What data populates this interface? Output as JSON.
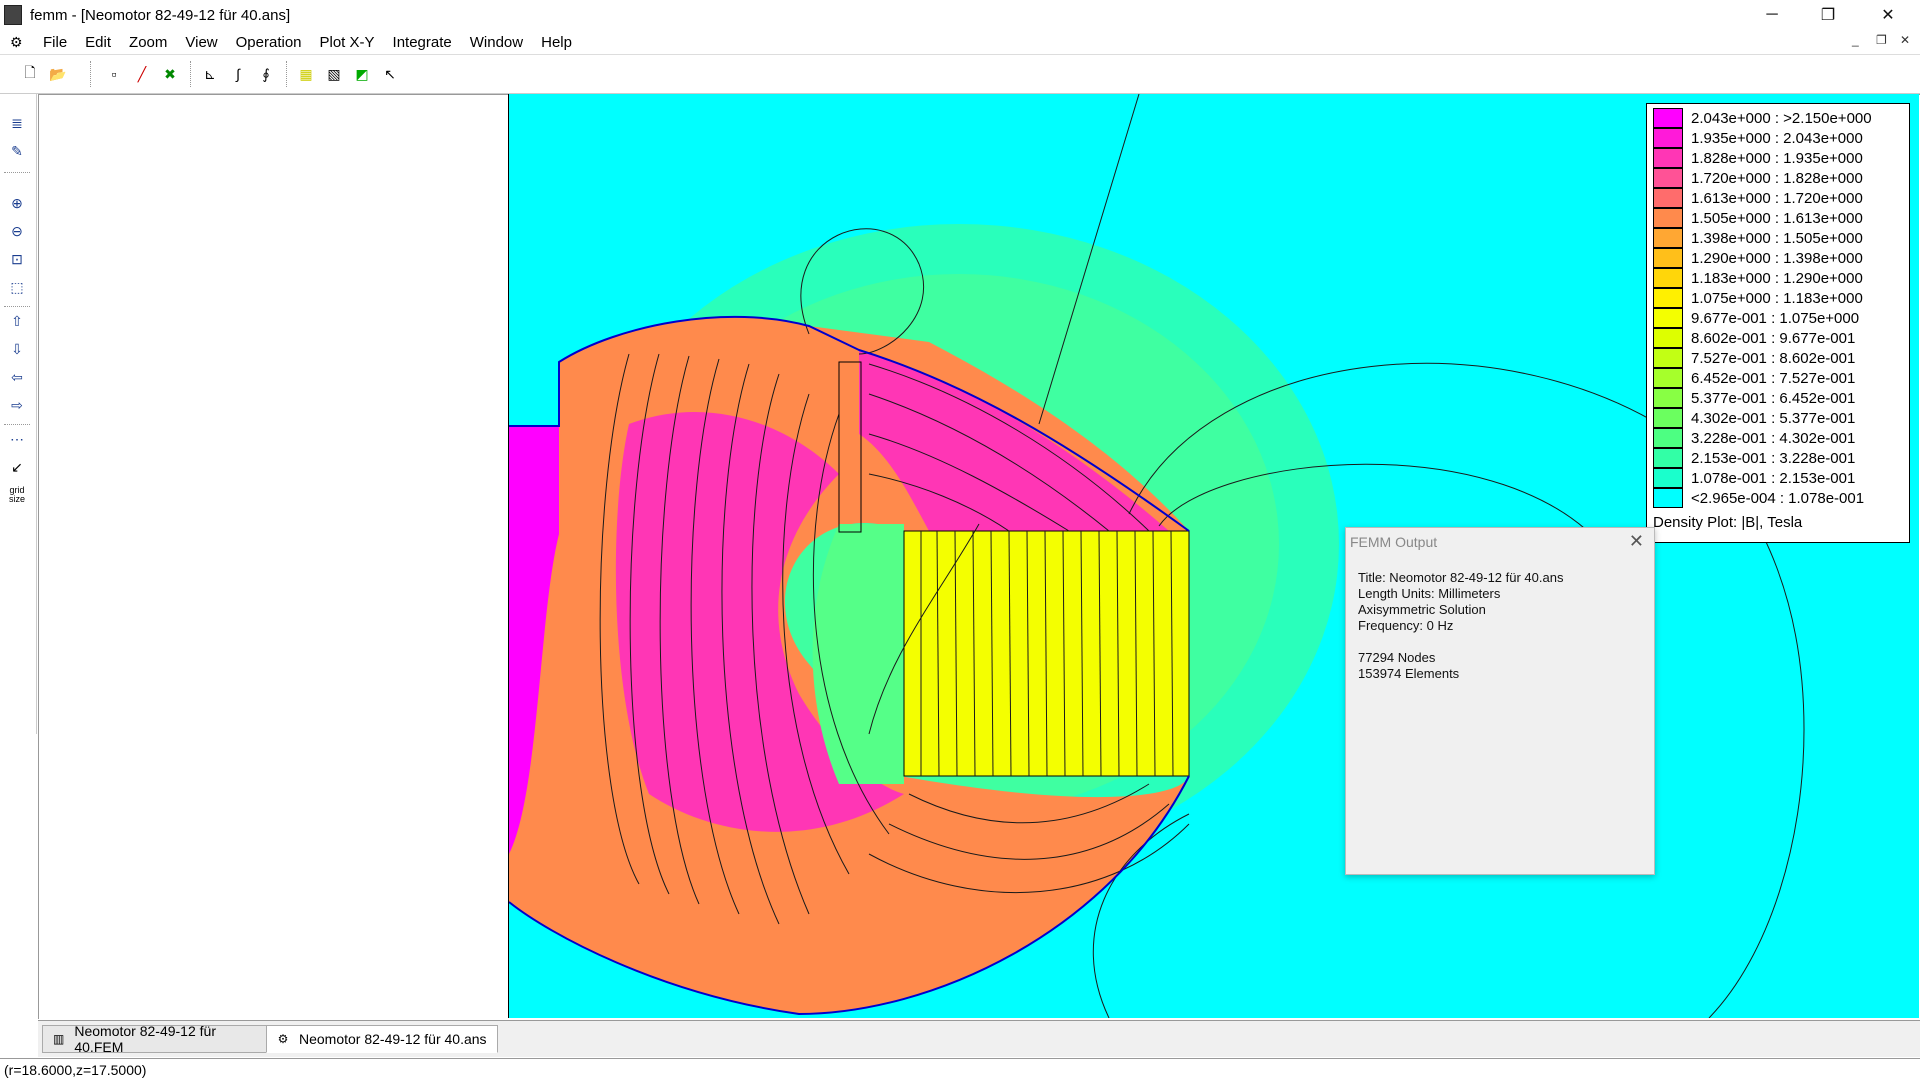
{
  "window": {
    "title": "femm - [Neomotor 82-49-12 für 40.ans]",
    "minimize_glyph": "─",
    "restore_glyph": "❐",
    "close_glyph": "✕"
  },
  "menu": {
    "items": [
      "File",
      "Edit",
      "Zoom",
      "View",
      "Operation",
      "Plot X-Y",
      "Integrate",
      "Window",
      "Help"
    ],
    "mdi_minimize": "_",
    "mdi_restore": "❐",
    "mdi_close": "✕"
  },
  "toolbar": {
    "buttons": [
      {
        "icon": "new-document-icon",
        "glyph": "🗋"
      },
      {
        "icon": "open-folder-icon",
        "glyph": "📂"
      },
      {
        "icon": "point-mode-icon",
        "glyph": "▫"
      },
      {
        "icon": "contour-line-icon",
        "glyph": "╱"
      },
      {
        "icon": "area-mode-icon",
        "glyph": "✖"
      },
      {
        "icon": "plot-xy-icon",
        "glyph": "⊾"
      },
      {
        "icon": "line-integral-icon",
        "glyph": "∫"
      },
      {
        "icon": "block-integral-icon",
        "glyph": "∮"
      },
      {
        "icon": "show-mesh-icon",
        "glyph": "▦"
      },
      {
        "icon": "contour-plot-icon",
        "glyph": "▧"
      },
      {
        "icon": "density-plot-icon",
        "glyph": "◩"
      },
      {
        "icon": "vector-plot-icon",
        "glyph": "↖"
      }
    ]
  },
  "sidebar": {
    "buttons": [
      {
        "icon": "view-results-icon",
        "glyph": "≣"
      },
      {
        "icon": "edit-notes-icon",
        "glyph": "✎"
      },
      {
        "icon": "zoom-in-icon",
        "glyph": "⊕"
      },
      {
        "icon": "zoom-out-icon",
        "glyph": "⊖"
      },
      {
        "icon": "zoom-natural-icon",
        "glyph": "⊡"
      },
      {
        "icon": "zoom-window-icon",
        "glyph": "⬚"
      },
      {
        "icon": "pan-up-icon",
        "glyph": "⇧"
      },
      {
        "icon": "pan-down-icon",
        "glyph": "⇩"
      },
      {
        "icon": "pan-left-icon",
        "glyph": "⇦"
      },
      {
        "icon": "pan-right-icon",
        "glyph": "⇨"
      },
      {
        "icon": "show-grid-icon",
        "glyph": "⋯"
      },
      {
        "icon": "snap-grid-icon",
        "glyph": "↙"
      },
      {
        "icon": "grid-size-icon",
        "glyph": "grid size"
      }
    ]
  },
  "legend": {
    "title": "Density Plot: |B|, Tesla",
    "entries": [
      {
        "label": "2.043e+000 : >2.150e+000",
        "color": "#ff00ff"
      },
      {
        "label": "1.935e+000 : 2.043e+000",
        "color": "#ff1ad9"
      },
      {
        "label": "1.828e+000 : 1.935e+000",
        "color": "#ff36b5"
      },
      {
        "label": "1.720e+000 : 1.828e+000",
        "color": "#ff5296"
      },
      {
        "label": "1.613e+000 : 1.720e+000",
        "color": "#ff6c6c"
      },
      {
        "label": "1.505e+000 : 1.613e+000",
        "color": "#ff8a4c"
      },
      {
        "label": "1.398e+000 : 1.505e+000",
        "color": "#ffa733"
      },
      {
        "label": "1.290e+000 : 1.398e+000",
        "color": "#ffbf1a"
      },
      {
        "label": "1.183e+000 : 1.290e+000",
        "color": "#ffd60a"
      },
      {
        "label": "1.075e+000 : 1.183e+000",
        "color": "#fff000"
      },
      {
        "label": "9.677e-001 : 1.075e+000",
        "color": "#f4ff00"
      },
      {
        "label": "8.602e-001 : 9.677e-001",
        "color": "#ddff00"
      },
      {
        "label": "7.527e-001 : 8.602e-001",
        "color": "#c2ff14"
      },
      {
        "label": "6.452e-001 : 7.527e-001",
        "color": "#a6ff2b"
      },
      {
        "label": "5.377e-001 : 6.452e-001",
        "color": "#88ff44"
      },
      {
        "label": "4.302e-001 : 5.377e-001",
        "color": "#6bff5f"
      },
      {
        "label": "3.228e-001 : 4.302e-001",
        "color": "#4dff82"
      },
      {
        "label": "2.153e-001 : 3.228e-001",
        "color": "#32ffa6"
      },
      {
        "label": "1.078e-001 : 2.153e-001",
        "color": "#1affcc"
      },
      {
        "label": "<2.965e-004 : 1.078e-001",
        "color": "#00ffff"
      }
    ]
  },
  "output": {
    "window_title": "FEMM Output",
    "close_glyph": "✕",
    "lines": [
      "Title: Neomotor 82-49-12 für 40.ans",
      "Length Units: Millimeters",
      "Axisymmetric Solution",
      "Frequency: 0 Hz",
      "",
      "77294 Nodes",
      "153974 Elements"
    ]
  },
  "tabs": [
    {
      "label": "Neomotor 82-49-12 für 40.FEM",
      "icon": "fem-document-icon",
      "glyph": "▥"
    },
    {
      "label": "Neomotor 82-49-12 für 40.ans",
      "icon": "ans-document-icon",
      "glyph": "⚙"
    }
  ],
  "status": {
    "coords": "(r=18.6000,z=17.5000)"
  },
  "colors": {
    "background_field": "#00ffff",
    "magnet": "#f4ff00",
    "contour": "#1a1a1a"
  }
}
